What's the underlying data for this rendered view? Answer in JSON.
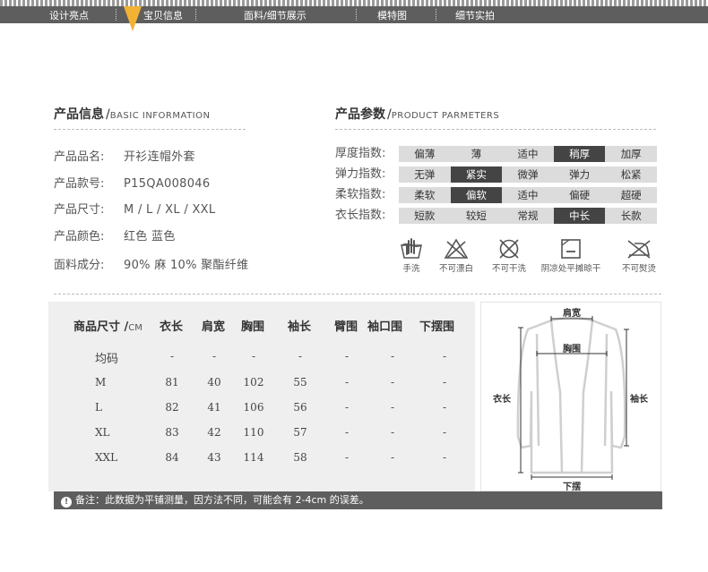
{
  "nav": {
    "tabs": [
      "设计亮点",
      "宝贝信息",
      "面料/细节展示",
      "模特图",
      "细节实拍"
    ],
    "active_index": 1
  },
  "product_info": {
    "title": "产品信息",
    "subtitle": "BASIC INFORMATION",
    "rows": [
      {
        "label": "产品品名:",
        "value": "开衫连帽外套"
      },
      {
        "label": "产品款号:",
        "value": "P15QA008046"
      },
      {
        "label": "产品尺寸:",
        "value": "M / L / XL / XXL"
      },
      {
        "label": "产品颜色:",
        "value": "红色 蓝色"
      },
      {
        "label": "面料成分:",
        "value": "90% 麻  10% 聚酯纤维"
      }
    ]
  },
  "product_params": {
    "title": "产品参数",
    "subtitle": "PRODUCT PARMETERS",
    "rows": [
      {
        "label": "厚度指数:",
        "options": [
          "偏薄",
          "薄",
          "适中",
          "稍厚",
          "加厚"
        ],
        "selected": 3
      },
      {
        "label": "弹力指数:",
        "options": [
          "无弹",
          "紧实",
          "微弹",
          "弹力",
          "松紧"
        ],
        "selected": 1
      },
      {
        "label": "柔软指数:",
        "options": [
          "柔软",
          "偏软",
          "适中",
          "偏硬",
          "超硬"
        ],
        "selected": 1
      },
      {
        "label": "衣长指数:",
        "options": [
          "短款",
          "较短",
          "常规",
          "中长",
          "长款"
        ],
        "selected": 3
      }
    ]
  },
  "care": [
    {
      "icon": "hand-wash-icon",
      "label": "手洗"
    },
    {
      "icon": "no-bleach-icon",
      "label": "不可漂白"
    },
    {
      "icon": "no-tumble-dry-icon",
      "label": "不可干洗"
    },
    {
      "icon": "dry-flat-shade-icon",
      "label": "阴凉处平摊晾干"
    },
    {
      "icon": "no-iron-icon",
      "label": "不可熨烫"
    }
  ],
  "size_table": {
    "title": "商品尺寸",
    "unit": "CM",
    "headers": [
      "衣长",
      "肩宽",
      "胸围",
      "袖长",
      "臂围",
      "袖口围",
      "下摆围"
    ],
    "rows": [
      {
        "size": "均码",
        "values": [
          "-",
          "-",
          "-",
          "-",
          "-",
          "-",
          "-"
        ]
      },
      {
        "size": "M",
        "values": [
          "81",
          "40",
          "102",
          "55",
          "-",
          "-",
          "-"
        ]
      },
      {
        "size": "L",
        "values": [
          "82",
          "41",
          "106",
          "56",
          "-",
          "-",
          "-"
        ]
      },
      {
        "size": "XL",
        "values": [
          "83",
          "42",
          "110",
          "57",
          "-",
          "-",
          "-"
        ]
      },
      {
        "size": "XXL",
        "values": [
          "84",
          "43",
          "114",
          "58",
          "-",
          "-",
          "-"
        ]
      }
    ]
  },
  "diagram": {
    "shoulder": "肩宽",
    "chest": "胸围",
    "length": "衣长",
    "sleeve": "袖长",
    "hem": "下摆"
  },
  "note": {
    "text": "备注：此数据为平铺测量，因方法不同，可能会有 2-4cm 的误差。"
  },
  "colors": {
    "nav_bg": "#5e5e5e",
    "selected_cell": "#444444",
    "cell_bg": "#dcdcdc",
    "table_bg": "#efefef"
  }
}
